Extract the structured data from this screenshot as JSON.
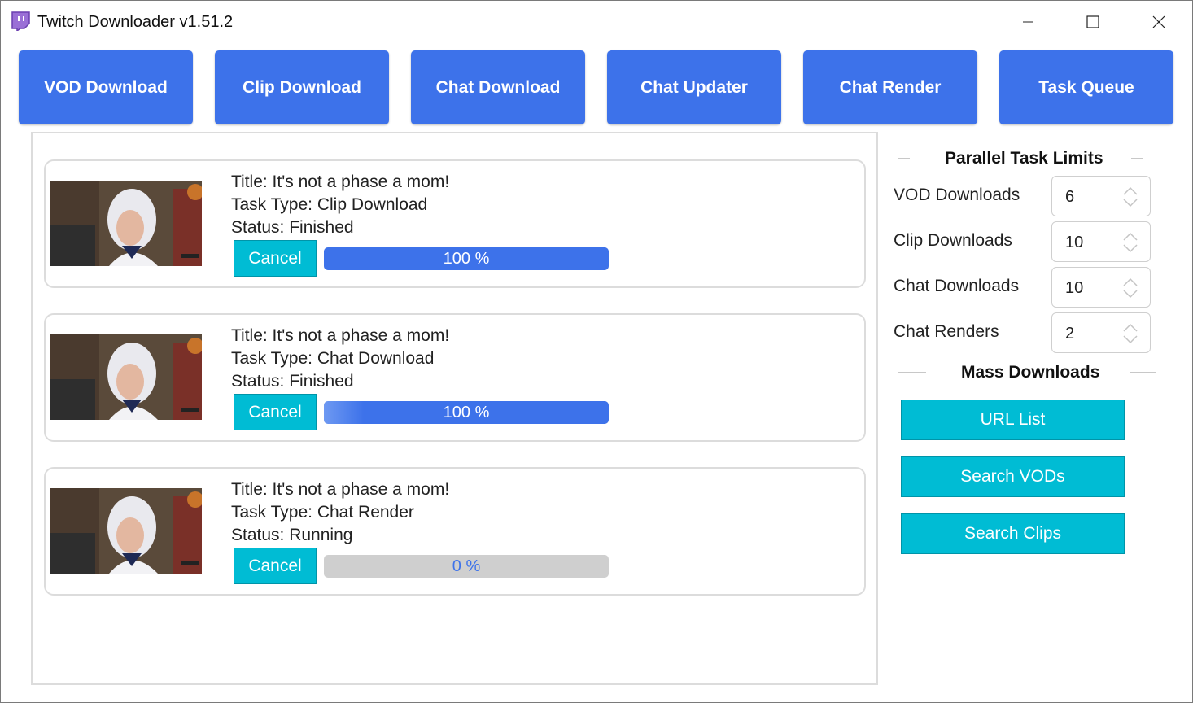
{
  "window": {
    "title": "Twitch Downloader v1.51.2",
    "icon": "twitch-glitch-icon",
    "controls": [
      "minimize-icon",
      "maximize-icon",
      "close-icon"
    ]
  },
  "nav": {
    "vod_download": "VOD Download",
    "clip_download": "Clip Download",
    "chat_download": "Chat Download",
    "chat_updater": "Chat Updater",
    "chat_render": "Chat Render",
    "task_queue": "Task Queue"
  },
  "tasks": [
    {
      "title": "Title: It's not a phase a mom!",
      "type": "Task Type: Clip Download",
      "status": "Status: Finished",
      "cancel": "Cancel",
      "progress": 1.0,
      "progress_text": "100 %"
    },
    {
      "title": "Title: It's not a phase a mom!",
      "type": "Task Type: Chat Download",
      "status": "Status: Finished",
      "cancel": "Cancel",
      "progress": 1.0,
      "progress_text": "100 %"
    },
    {
      "title": "Title: It's not a phase a mom!",
      "type": "Task Type: Chat Render",
      "status": "Status: Running",
      "cancel": "Cancel",
      "progress": 0.0,
      "progress_text": "0 %"
    }
  ],
  "limits": {
    "heading": "Parallel Task Limits",
    "items": [
      {
        "label": "VOD Downloads",
        "value": "6"
      },
      {
        "label": "Clip Downloads",
        "value": "10"
      },
      {
        "label": "Chat Downloads",
        "value": "10"
      },
      {
        "label": "Chat Renders",
        "value": "2"
      }
    ]
  },
  "mass": {
    "heading": "Mass Downloads",
    "url_list": "URL List",
    "search_vods": "Search VODs",
    "search_clips": "Search Clips"
  },
  "colors": {
    "accent_blue": "#3d72ea",
    "accent_cyan": "#00bcd4",
    "progress_track": "#cfcfcf"
  }
}
